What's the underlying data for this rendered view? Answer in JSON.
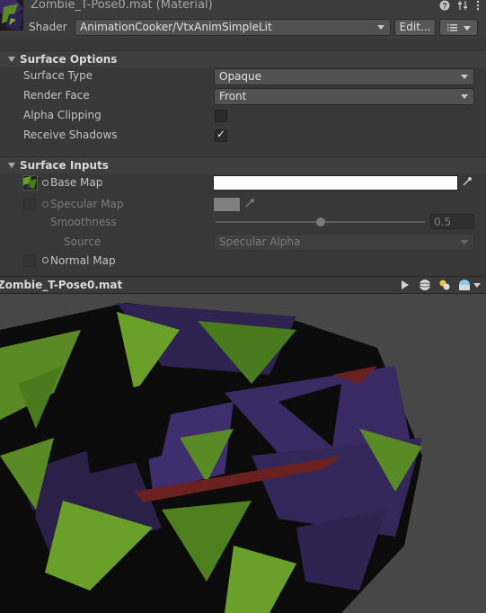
{
  "header": {
    "title": "Zombie_T-Pose0.mat (Material)",
    "shader_label": "Shader",
    "shader_value": "AnimationCooker/VtxAnimSimpleLit",
    "edit_button": "Edit...",
    "icons": [
      "help-icon",
      "presets-icon",
      "kebab-menu-icon"
    ]
  },
  "surface_options": {
    "title": "Surface Options",
    "rows": [
      {
        "label": "Surface Type",
        "value": "Opaque"
      },
      {
        "label": "Render Face",
        "value": "Front"
      },
      {
        "label": "Alpha Clipping",
        "checked": false
      },
      {
        "label": "Receive Shadows",
        "checked": true
      }
    ]
  },
  "surface_inputs": {
    "title": "Surface Inputs",
    "base_map": {
      "label": "Base Map",
      "color": "#ffffff"
    },
    "specular_map": {
      "label": "Specular Map",
      "color": "#7f7f7f"
    },
    "smoothness": {
      "label": "Smoothness",
      "value": "0.5",
      "level": 0.5
    },
    "source": {
      "label": "Source",
      "value": "Specular Alpha"
    },
    "normal_map": {
      "label": "Normal Map"
    }
  },
  "preview": {
    "title": "Zombie_T-Pose0.mat",
    "icons": [
      "play-icon",
      "sphere-mesh-icon",
      "light-icon",
      "skybox-icon"
    ],
    "colors": {
      "purple": "#3a2a63",
      "green": "#5a8a25",
      "red": "#6b2020",
      "black": "#0b0b0b"
    }
  }
}
